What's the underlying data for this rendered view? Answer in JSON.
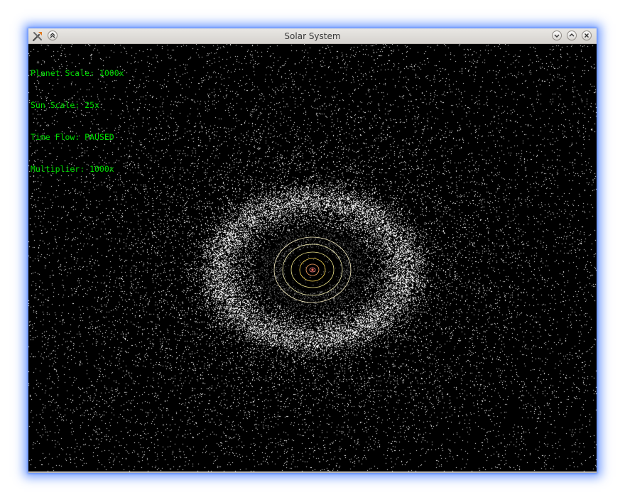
{
  "window": {
    "title": "Solar System"
  },
  "titlebar_buttons": {
    "left": [
      "app-menu-icon",
      "shade-icon"
    ],
    "right": [
      "minimize-icon",
      "maximize-icon",
      "close-icon"
    ]
  },
  "hud": {
    "planet_scale": "Planet Scale: 1000x",
    "sun_scale": "Sun Scale: 25x",
    "time_flow": "Time Flow: PAUSED",
    "multiplier": "Multiplier: 1000x"
  },
  "colors": {
    "hud_text": "#00e000",
    "background": "#000000",
    "particles": "#ffffff",
    "orbit_colors": [
      "#ff8888",
      "#ffaa66",
      "#ffdd55",
      "#f0e68c",
      "#f5f0b0",
      "#fff5c8"
    ],
    "sun": "#ff6a5a",
    "window_glow": "#5a8cff"
  }
}
